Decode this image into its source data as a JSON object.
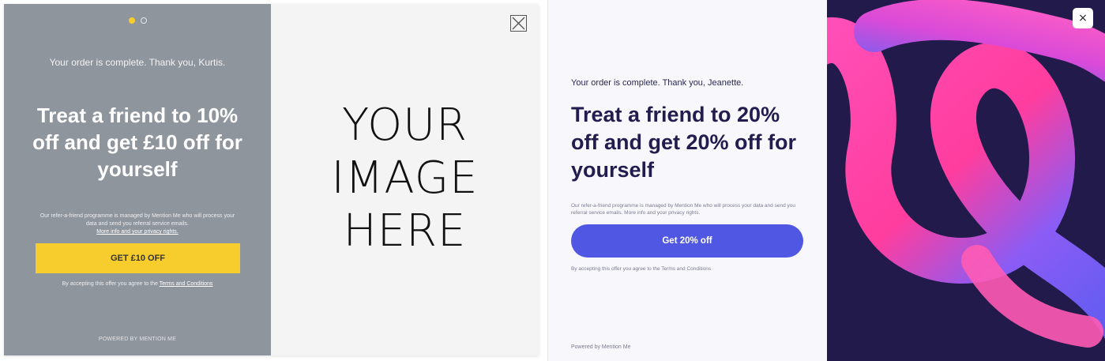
{
  "left_modal": {
    "carousel": {
      "page_count": 2,
      "active_index": 0
    },
    "thanks_text": "Your order is complete. Thank you, Kurtis.",
    "headline": "Treat a friend to 10% off and get £10 off for yourself",
    "privacy_text": "Our refer-a-friend programme is managed by Mention Me who will process your data and send you referral service emails.",
    "privacy_link": "More info and your privacy rights.",
    "cta_label": "GET £10 OFF",
    "terms_prefix": "By accepting this offer you agree to the",
    "terms_link": "Terms and Conditions",
    "powered_by": "POWERED BY MENTION ME",
    "image_placeholder_lines": [
      "YOUR",
      "IMAGE",
      "HERE"
    ],
    "close_icon": "close-icon",
    "colors": {
      "panel": "#8f959d",
      "accent": "#f7cd2e",
      "image_bg": "#f4f4f4"
    }
  },
  "right_modal": {
    "thanks_text": "Your order is complete. Thank you, Jeanette.",
    "headline": "Treat a friend to 20% off and get 20% off for yourself",
    "privacy_text": "Our refer-a-friend programme is managed by Mention Me who will process your data and send you referral service emails. More info and your privacy rights.",
    "cta_label": "Get 20% off",
    "terms_text": "By accepting this offer you agree to the Terms and Conditions",
    "powered_by": "Powered by Mention Me",
    "close_glyph": "×",
    "close_icon": "close-icon",
    "colors": {
      "background": "#f8f8fc",
      "headline": "#221c4f",
      "button": "#4f57e3",
      "art_bg": "#211a4a",
      "art_pink": "#ff4fb8",
      "art_blue": "#5b5cf0"
    }
  }
}
